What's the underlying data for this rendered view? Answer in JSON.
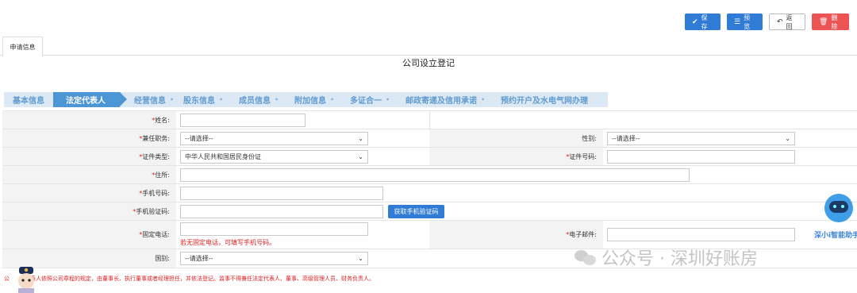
{
  "toolbar": {
    "save_label": "保存",
    "preview_label": "预览",
    "back_label": "返回",
    "delete_label": "删除"
  },
  "tabs": [
    {
      "label": "申请信息"
    }
  ],
  "page_title": "公司设立登记",
  "steps": [
    {
      "label": "基本信息"
    },
    {
      "label": "法定代表人"
    },
    {
      "label": "经营信息"
    },
    {
      "label": "股东信息"
    },
    {
      "label": "成员信息"
    },
    {
      "label": "附加信息"
    },
    {
      "label": "多证合一"
    },
    {
      "label": "邮政寄递及信用承诺"
    },
    {
      "label": "预约开户及水电气网办理"
    }
  ],
  "active_step": "法定代表人",
  "form": {
    "name_label": "姓名:",
    "concurrent_post_label": "兼任职务:",
    "concurrent_post_value": "--请选择--",
    "gender_label": "性别:",
    "gender_value": "--请选择--",
    "id_type_label": "证件类型:",
    "id_type_value": "中华人民共和国居民身份证",
    "id_number_label": "证件号码:",
    "address_label": "住所:",
    "mobile_label": "手机号码:",
    "sms_code_label": "手机验证码:",
    "get_sms_code_button": "获取手机验证码",
    "landline_label": "固定电话:",
    "landline_hint": "若无固定电话，可填写手机号码。",
    "email_label": "电子邮件:",
    "nationality_label": "国别:",
    "nationality_value": "--请选择--",
    "required_mark": "*"
  },
  "notice_text": "公司法定代表人依照公司章程的规定，由董事长、执行董事或者经理担任，并依法登记。监事不得兼任法定代表人、董事、高级管理人员、财务负责人。",
  "notice_visible_fragment_left": "公",
  "notice_visible_text": "表人依照公司章程的规定，由董事长、执行董事或者经理担任，并依法登记。监事不得兼任法定代表人、董事、高级管理人员、财务负责人。",
  "assistant_label": "深小i智能助手",
  "watermark_text": "公众号 · 深圳好账房",
  "colors": {
    "primary": "#2f7bd6",
    "danger": "#ec5353",
    "step_bar": "#dce9f5",
    "step_active": "#4d96d6",
    "required": "#e02020"
  }
}
